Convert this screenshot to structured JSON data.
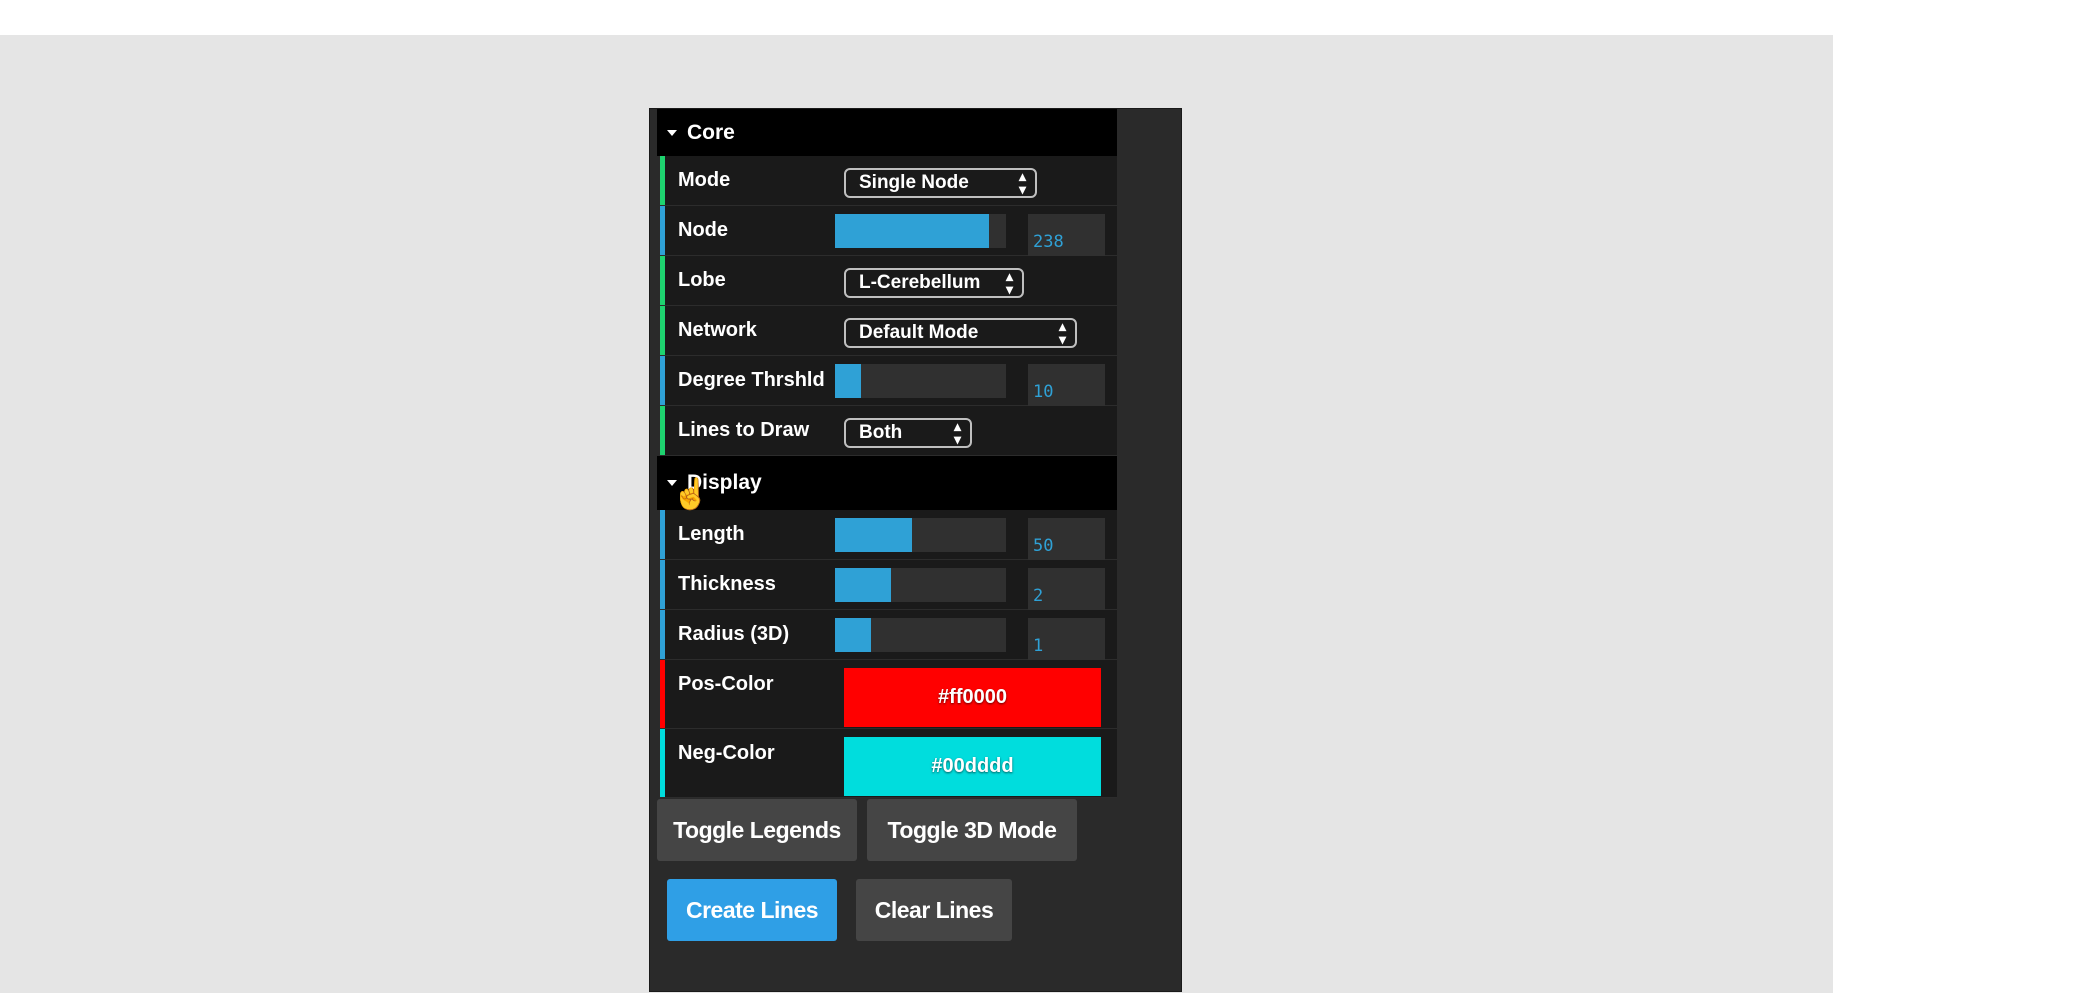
{
  "core": {
    "title": "Core",
    "mode": {
      "label": "Mode",
      "value": "Single Node"
    },
    "node": {
      "label": "Node",
      "value": "238",
      "fraction": 0.9
    },
    "lobe": {
      "label": "Lobe",
      "value": "L-Cerebellum"
    },
    "network": {
      "label": "Network",
      "value": "Default Mode"
    },
    "degree": {
      "label": "Degree Thrshld",
      "value": "10",
      "fraction": 0.15
    },
    "lines": {
      "label": "Lines to Draw",
      "value": "Both"
    }
  },
  "display": {
    "title": "Display",
    "length": {
      "label": "Length",
      "value": "50",
      "fraction": 0.45
    },
    "thickness": {
      "label": "Thickness",
      "value": "2",
      "fraction": 0.33
    },
    "radius": {
      "label": "Radius (3D)",
      "value": "1",
      "fraction": 0.21
    },
    "pos_color": {
      "label": "Pos-Color",
      "value": "#ff0000"
    },
    "neg_color": {
      "label": "Neg-Color",
      "value": "#00dddd"
    }
  },
  "buttons": {
    "toggle_legends": "Toggle Legends",
    "toggle_3d": "Toggle 3D Mode",
    "create_lines": "Create Lines",
    "clear_lines": "Clear Lines"
  },
  "colors": {
    "accent": "#2fa1d6",
    "select_stripe": "#1ed36f",
    "number_stripe": "#2fa1d6",
    "pos": "#ff0000",
    "neg": "#00dddd",
    "create_button": "#2f9fe6"
  }
}
